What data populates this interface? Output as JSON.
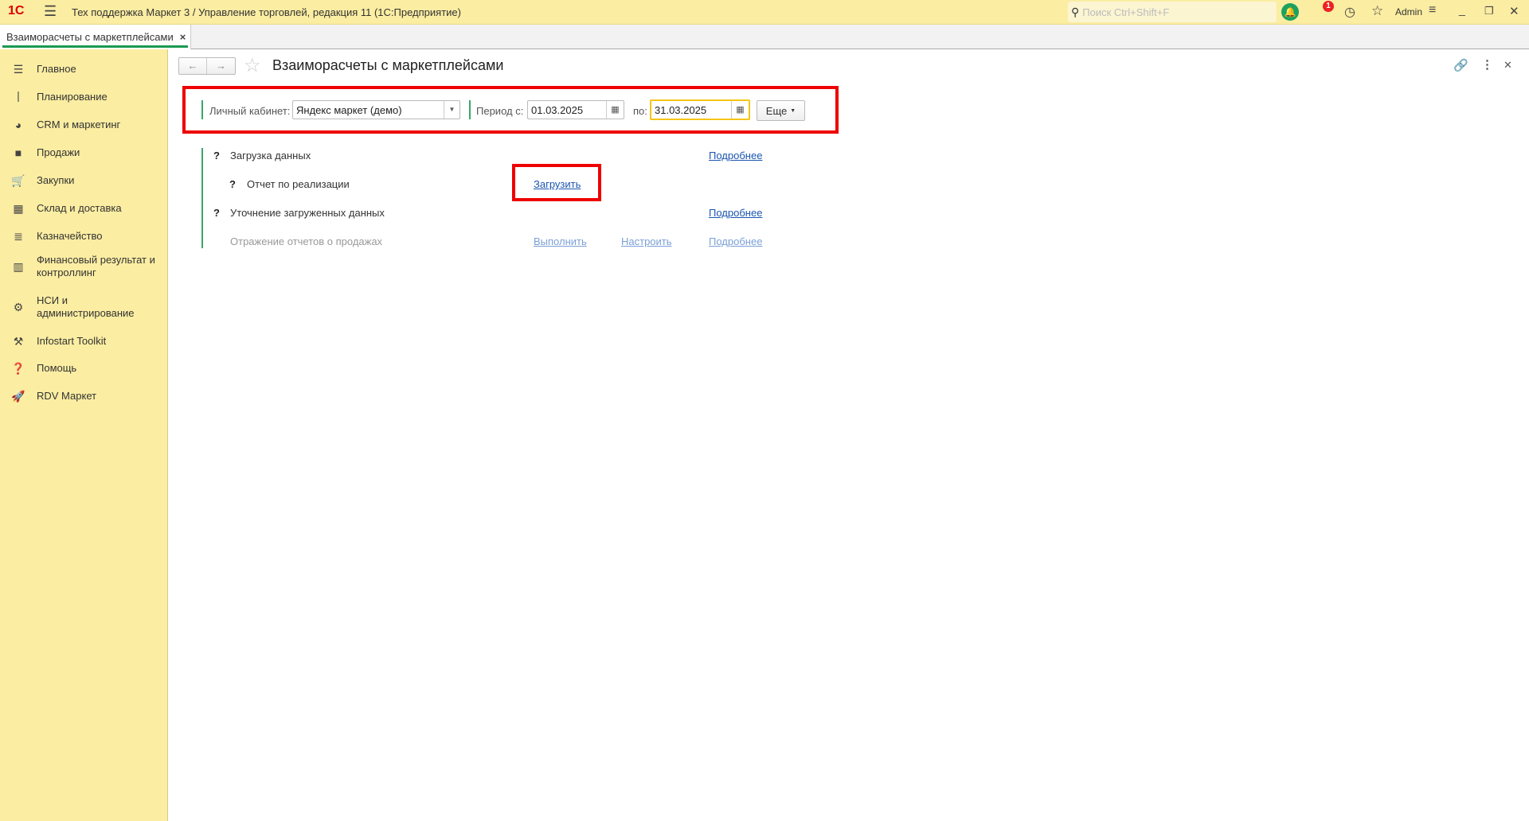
{
  "window": {
    "title": "Тех поддержка Маркет 3 / Управление торговлей, редакция 11  (1С:Предприятие)",
    "search_placeholder": "Поиск Ctrl+Shift+F",
    "notifications_count": "1",
    "user": "Admin"
  },
  "tabs": [
    {
      "label": "Взаиморасчеты с маркетплейсами"
    }
  ],
  "sidebar": {
    "items": [
      {
        "label": "Главное"
      },
      {
        "label": "Планирование"
      },
      {
        "label": "CRM и маркетинг"
      },
      {
        "label": "Продажи"
      },
      {
        "label": "Закупки"
      },
      {
        "label": "Склад и доставка"
      },
      {
        "label": "Казначейство"
      },
      {
        "label": "Финансовый результат и контроллинг"
      },
      {
        "label": "НСИ и администрирование"
      },
      {
        "label": "Infostart Toolkit"
      },
      {
        "label": "Помощь"
      },
      {
        "label": "RDV Маркет"
      }
    ]
  },
  "form": {
    "title": "Взаиморасчеты с маркетплейсами",
    "account_label": "Личный кабинет:",
    "account_value": "Яндекс маркет (демо)",
    "period_from_label": "Период с:",
    "period_from": "01.03.2025",
    "period_to_label": "по:",
    "period_to": "31.03.2025",
    "more_button": "Еще",
    "rows": [
      {
        "q": "?",
        "label": "Загрузка данных",
        "details": "Подробнее"
      },
      {
        "q": "?",
        "label": "Отчет по реализации",
        "action": "Загрузить"
      },
      {
        "q": "?",
        "label": "Уточнение загруженных данных",
        "details": "Подробнее"
      },
      {
        "label": "Отражение отчетов о продажах",
        "action": "Выполнить",
        "setup": "Настроить",
        "details": "Подробнее"
      }
    ]
  }
}
